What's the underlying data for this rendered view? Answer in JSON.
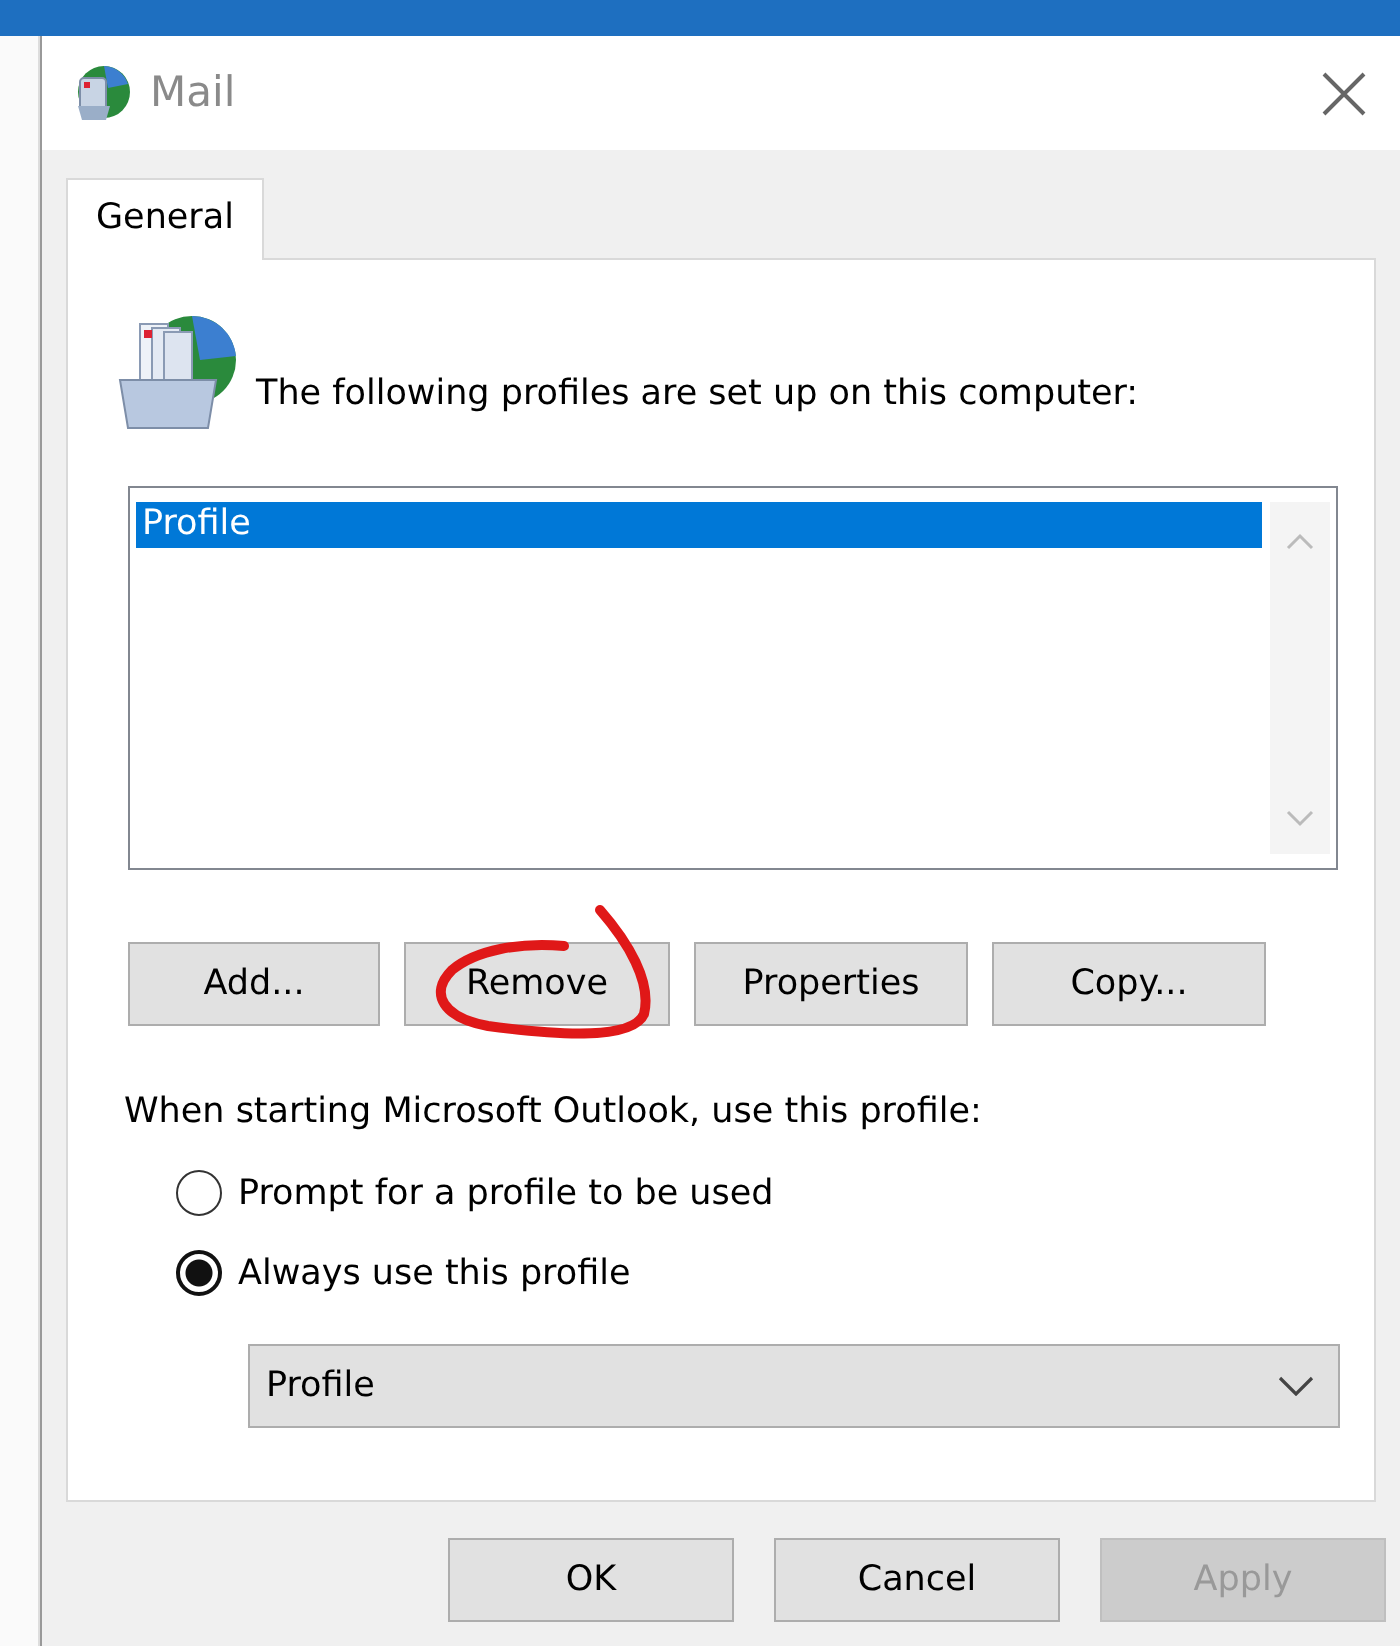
{
  "window": {
    "title": "Mail"
  },
  "tabs": [
    {
      "label": "General",
      "selected": true
    }
  ],
  "intro": "The following profiles are set up on this computer:",
  "profiles": [
    {
      "name": "Profile",
      "selected": true
    }
  ],
  "profile_buttons": [
    {
      "label": "Add..."
    },
    {
      "label": "Remove"
    },
    {
      "label": "Properties"
    },
    {
      "label": "Copy..."
    }
  ],
  "startup": {
    "label": "When starting Microsoft Outlook, use this profile:",
    "options": [
      {
        "label": "Prompt for a profile to be used",
        "selected": false
      },
      {
        "label": "Always use this profile",
        "selected": true
      }
    ],
    "profile_select": {
      "value": "Profile"
    }
  },
  "buttons": [
    {
      "label": "OK",
      "disabled": false
    },
    {
      "label": "Cancel",
      "disabled": false
    },
    {
      "label": "Apply",
      "disabled": true
    }
  ],
  "annotation": {
    "kind": "circle"
  }
}
